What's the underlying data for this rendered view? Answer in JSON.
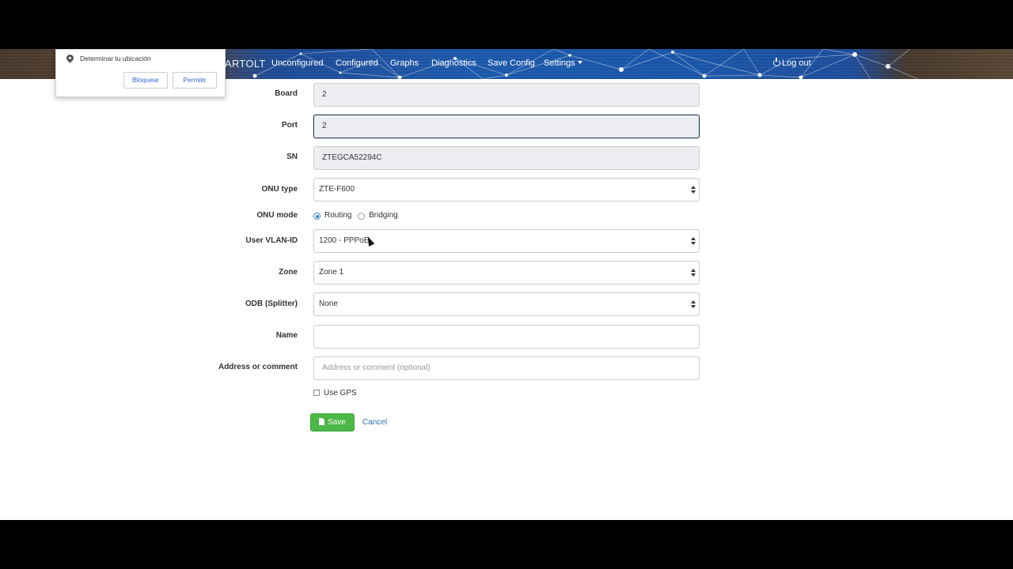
{
  "geo_popup": {
    "message": "Determinar tu ubicación",
    "block_label": "Bloquear",
    "allow_label": "Permitir"
  },
  "navbar": {
    "brand": "ARTOLT",
    "links": [
      "Unconfigured",
      "Configured",
      "Graphs",
      "Diagnostics",
      "Save Config",
      "Settings"
    ],
    "logout_label": "Log out"
  },
  "form": {
    "board": {
      "label": "Board",
      "value": "2"
    },
    "port": {
      "label": "Port",
      "value": "2"
    },
    "sn": {
      "label": "SN",
      "value": "ZTEGCA52294C"
    },
    "onu_type": {
      "label": "ONU type",
      "value": "ZTE-F600"
    },
    "onu_mode": {
      "label": "ONU mode",
      "options": [
        "Routing",
        "Bridging"
      ],
      "selected": "Routing"
    },
    "user_vlan": {
      "label": "User VLAN-ID",
      "value": "1200 - PPPoE"
    },
    "zone": {
      "label": "Zone",
      "value": "Zone 1"
    },
    "odb": {
      "label": "ODB (Splitter)",
      "value": "None"
    },
    "name": {
      "label": "Name",
      "value": ""
    },
    "address": {
      "label": "Address or comment",
      "value": "",
      "placeholder": "Address or comment (optional)"
    },
    "use_gps": {
      "label": "Use GPS",
      "checked": false
    },
    "save_label": "Save",
    "cancel_label": "Cancel"
  },
  "colors": {
    "save_button": "#4cb848",
    "link": "#2a6db5",
    "radio_accent": "#3b82d6",
    "navbar_blue": "#1d5bb0"
  }
}
